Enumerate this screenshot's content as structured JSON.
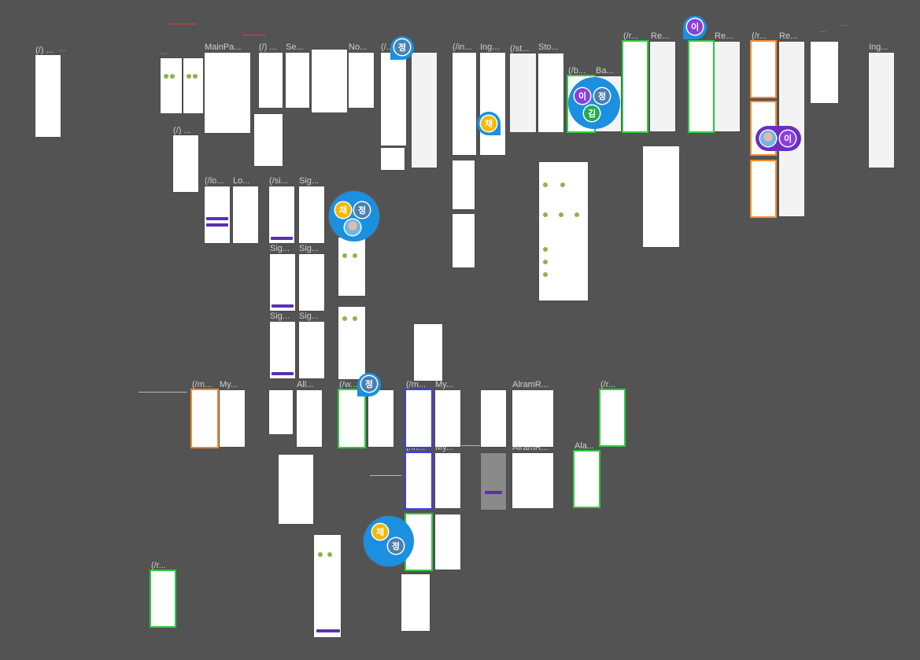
{
  "canvas": {
    "background": "#535353",
    "frame_outline_green": "#2ecc40",
    "frame_outline_orange": "#ff8a2a",
    "avatar_bubble": "#1b8fe0"
  },
  "labels": {
    "root": "(/) ...",
    "root_more": "...",
    "mainpage": "MainPa...",
    "root2": "(/) ...",
    "root3": "(/) ...",
    "se": "Se...",
    "no": "No...",
    "ing_a": "(/...ng...",
    "in1": "(/in...",
    "ing1": "Ing...",
    "st": "(/st...",
    "sto": "Sto...",
    "r1": "(/r...",
    "re1": "Re...",
    "re2": "Re...",
    "r2": "(/r...",
    "re3": "Re...",
    "top_more": "...",
    "ing2": "Ing...",
    "b": "(/b...",
    "ba": "Ba...",
    "lo": "(/lo...",
    "lo2": "Lo...",
    "si": "(/si...",
    "sig1": "Sig...",
    "sig2": "Sig...",
    "sig3": "Sig...",
    "sig4": "Sig...",
    "sig5": "Sig...",
    "m": "(/m...",
    "my": "My...",
    "all": "All...",
    "w": "(/w...",
    "m2": "(/m...",
    "my2": "My...",
    "alarmr": "AlramR...",
    "r3": "(/r...",
    "in2": "(/in...",
    "my3": "My...",
    "alarmr2": "AlramR...",
    "ala": "Ala...",
    "r4": "(/r...",
    "dots_a": "...",
    "dots_b": "..."
  },
  "avatars": [
    {
      "id": "a1",
      "text": "정",
      "color": "gray"
    },
    {
      "id": "a2",
      "text": "채",
      "color": "yellow"
    },
    {
      "id": "a3",
      "text": "이",
      "color": "purple"
    },
    {
      "id": "a4",
      "text": "정",
      "color": "gray"
    },
    {
      "id": "a5",
      "text": "김",
      "color": "green"
    },
    {
      "id": "a6",
      "text": "이",
      "color": "purple"
    },
    {
      "id": "a7",
      "text": "이",
      "color": "purple"
    },
    {
      "id": "a8",
      "text": "채",
      "color": "yellow"
    },
    {
      "id": "a9",
      "text": "정",
      "color": "gray"
    },
    {
      "id": "a10",
      "text": "정",
      "color": "gray"
    },
    {
      "id": "a11",
      "text": "채",
      "color": "yellow"
    },
    {
      "id": "a12",
      "text": "정",
      "color": "gray"
    }
  ]
}
